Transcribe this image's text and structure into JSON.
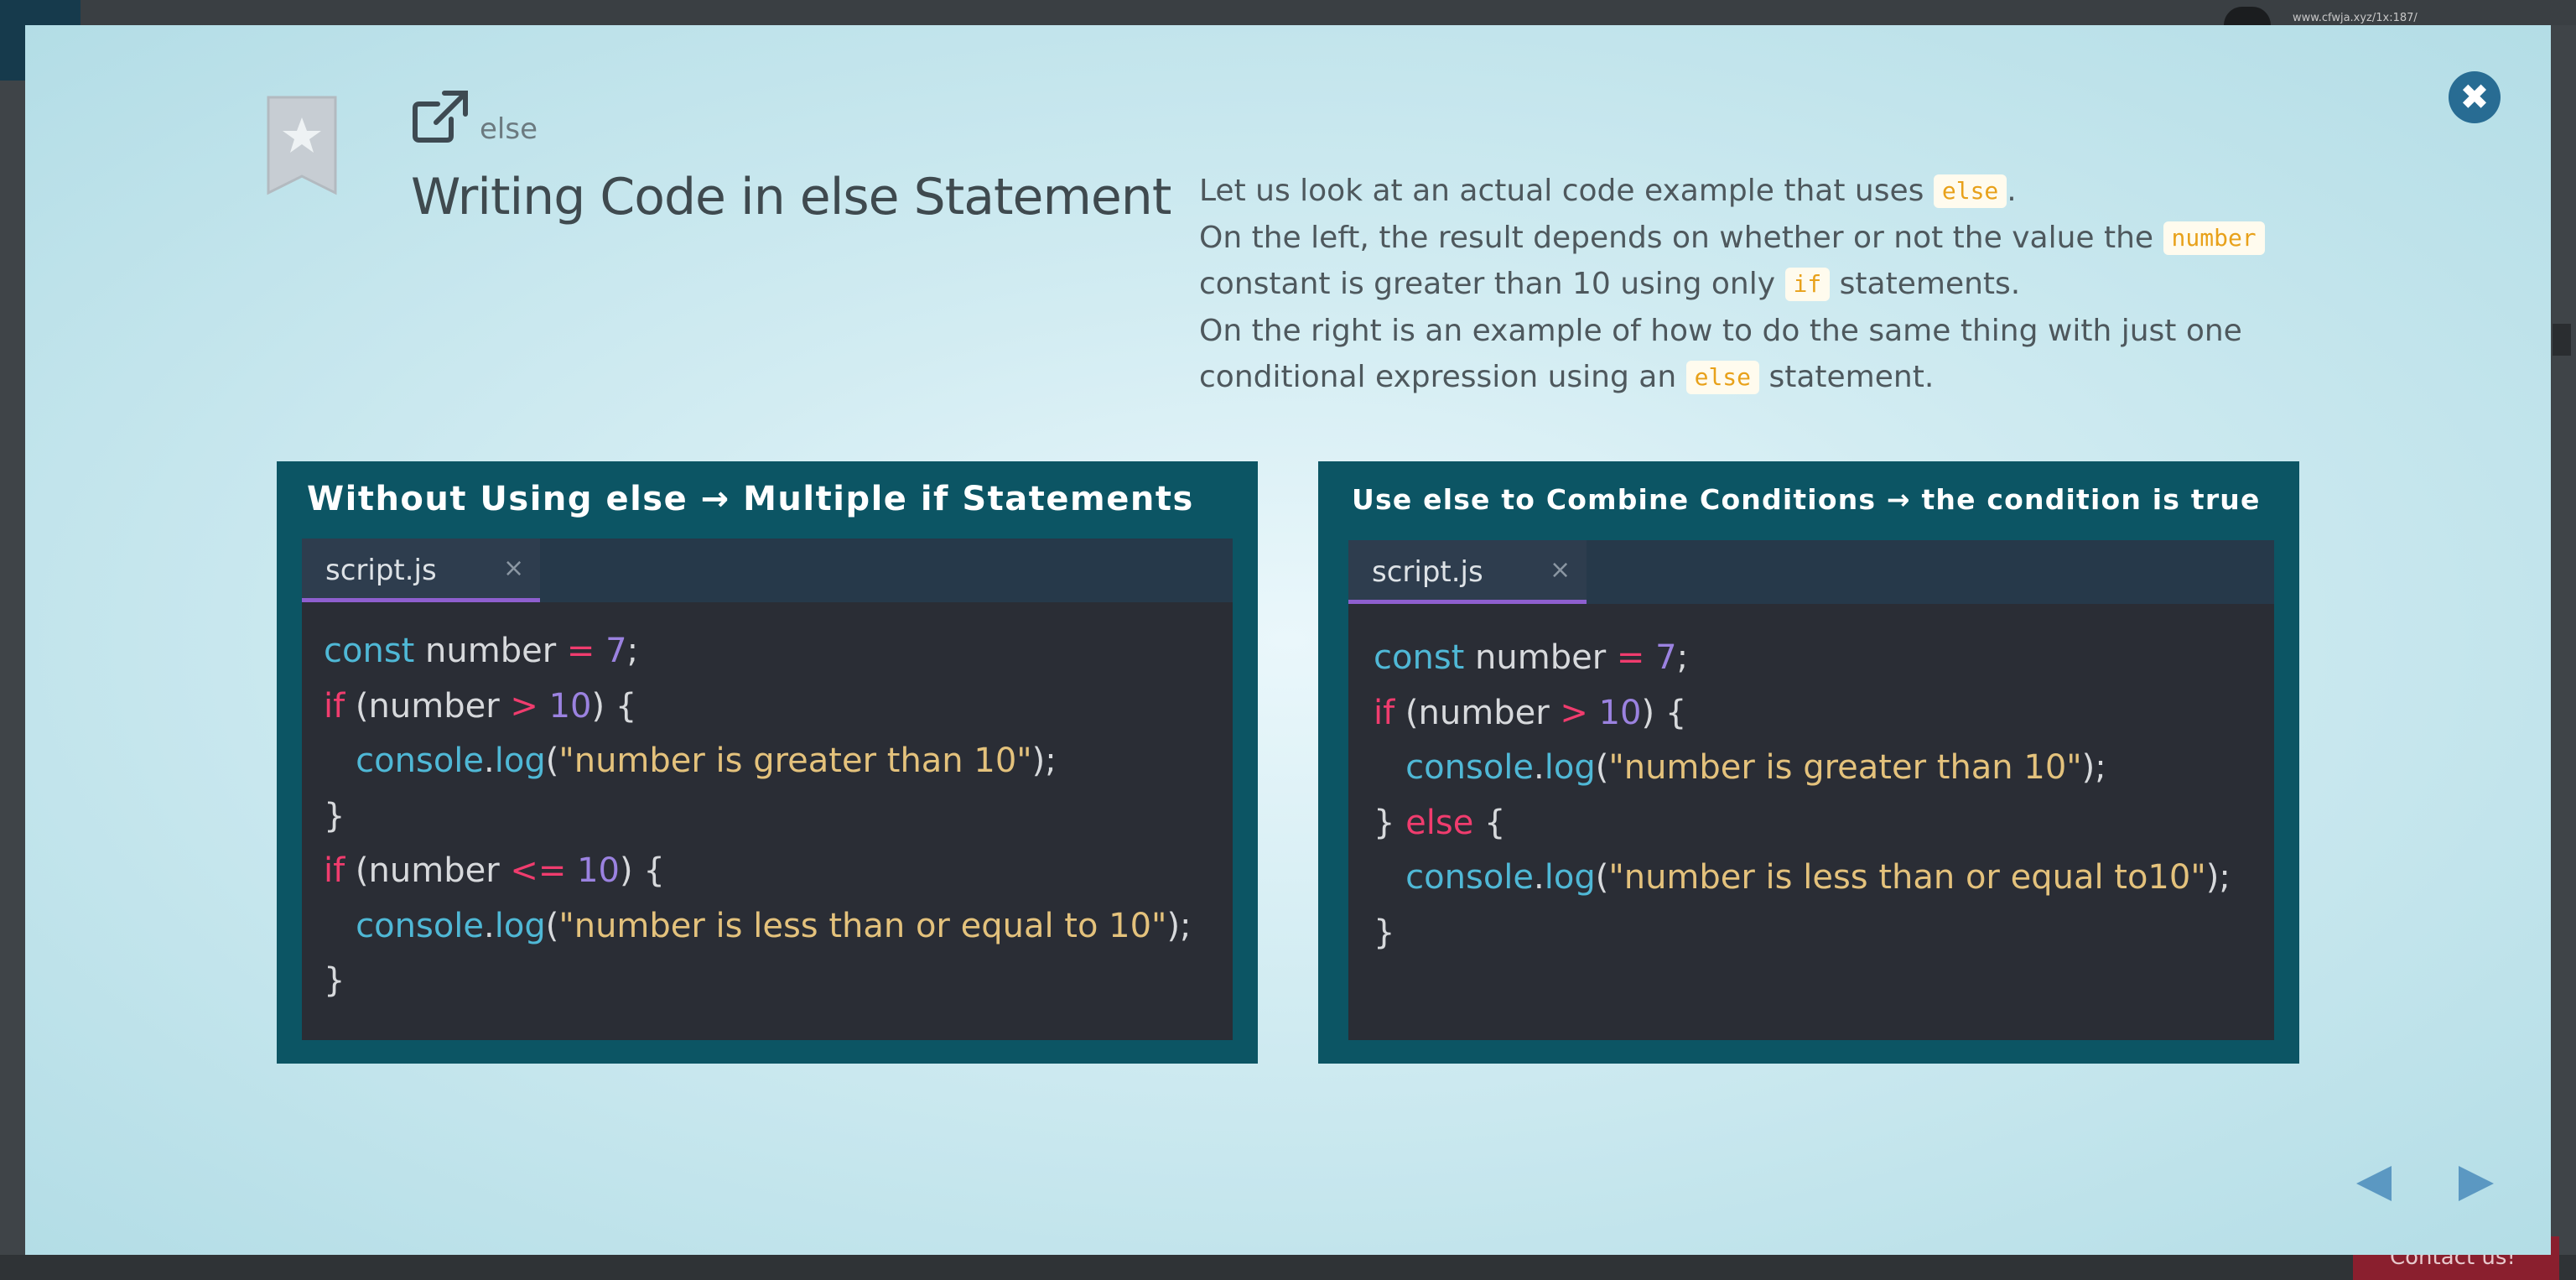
{
  "background": {
    "url_text": "www.cfwja.xyz/1x:187/",
    "contact_label": "Contact us!"
  },
  "modal": {
    "close_icon": "close-icon",
    "bookmark_icon": "bookmark-star-icon",
    "external_link_icon": "external-link-icon",
    "lesson_tag": "else",
    "title": "Writing Code in else Statement",
    "description": {
      "line1": {
        "before": "Let us look at an actual code example that uses ",
        "code": "else",
        "after": "."
      },
      "line2": {
        "before": "On the left, the result depends on whether or not the value the ",
        "code": "number",
        "after": ""
      },
      "line3": {
        "before": "constant is greater than 10 using only ",
        "code": "if",
        "after": " statements."
      },
      "line4": {
        "before": "On the right is an example of how to do the same thing with just one",
        "code": "",
        "after": ""
      },
      "line5": {
        "before": "conditional expression using an ",
        "code": "else",
        "after": " statement."
      }
    },
    "left_panel": {
      "title": "Without Using else → Multiple if Statements",
      "tab_label": "script.js",
      "tab_close": "×",
      "code_lines": [
        [
          [
            "kw",
            "const"
          ],
          [
            "plain",
            " number "
          ],
          [
            "op",
            "="
          ],
          [
            "plain",
            " "
          ],
          [
            "num",
            "7"
          ],
          [
            "plain",
            ";"
          ]
        ],
        [
          [
            "ctl",
            "if"
          ],
          [
            "plain",
            " (number "
          ],
          [
            "op",
            ">"
          ],
          [
            "plain",
            " "
          ],
          [
            "num",
            "10"
          ],
          [
            "plain",
            ") {"
          ]
        ],
        [
          [
            "plain",
            "   "
          ],
          [
            "fn",
            "console"
          ],
          [
            "plain",
            "."
          ],
          [
            "fn",
            "log"
          ],
          [
            "plain",
            "("
          ],
          [
            "str",
            "\"number is greater than 10\""
          ],
          [
            "plain",
            ");"
          ]
        ],
        [
          [
            "plain",
            "}"
          ]
        ],
        [
          [
            "ctl",
            "if"
          ],
          [
            "plain",
            " (number "
          ],
          [
            "op",
            "<="
          ],
          [
            "plain",
            " "
          ],
          [
            "num",
            "10"
          ],
          [
            "plain",
            ") {"
          ]
        ],
        [
          [
            "plain",
            "   "
          ],
          [
            "fn",
            "console"
          ],
          [
            "plain",
            "."
          ],
          [
            "fn",
            "log"
          ],
          [
            "plain",
            "("
          ],
          [
            "str",
            "\"number is less than or equal to 10\""
          ],
          [
            "plain",
            ");"
          ]
        ],
        [
          [
            "plain",
            "}"
          ]
        ]
      ]
    },
    "right_panel": {
      "title": "Use else to Combine Conditions → the condition is true",
      "tab_label": "script.js",
      "tab_close": "×",
      "code_lines": [
        [
          [
            "kw",
            "const"
          ],
          [
            "plain",
            " number "
          ],
          [
            "op",
            "="
          ],
          [
            "plain",
            " "
          ],
          [
            "num",
            "7"
          ],
          [
            "plain",
            ";"
          ]
        ],
        [
          [
            "ctl",
            "if"
          ],
          [
            "plain",
            " (number "
          ],
          [
            "op",
            ">"
          ],
          [
            "plain",
            " "
          ],
          [
            "num",
            "10"
          ],
          [
            "plain",
            ") {"
          ]
        ],
        [
          [
            "plain",
            "   "
          ],
          [
            "fn",
            "console"
          ],
          [
            "plain",
            "."
          ],
          [
            "fn",
            "log"
          ],
          [
            "plain",
            "("
          ],
          [
            "str",
            "\"number is greater than 10\""
          ],
          [
            "plain",
            ");"
          ]
        ],
        [
          [
            "plain",
            "} "
          ],
          [
            "ctl",
            "else"
          ],
          [
            "plain",
            " {"
          ]
        ],
        [
          [
            "plain",
            "   "
          ],
          [
            "fn",
            "console"
          ],
          [
            "plain",
            "."
          ],
          [
            "fn",
            "log"
          ],
          [
            "plain",
            "("
          ],
          [
            "str",
            "\"number is less than or equal to10\""
          ],
          [
            "plain",
            ");"
          ]
        ],
        [
          [
            "plain",
            "}"
          ]
        ]
      ]
    },
    "nav": {
      "prev_icon": "triangle-left-icon",
      "next_icon": "triangle-right-icon"
    },
    "colors": {
      "accent": "#286c93",
      "panel_bg": "#0c5564",
      "editor_bg": "#2a2d35",
      "tab_underline": "#8e5fcf",
      "inline_code": "#e8a11a"
    }
  }
}
